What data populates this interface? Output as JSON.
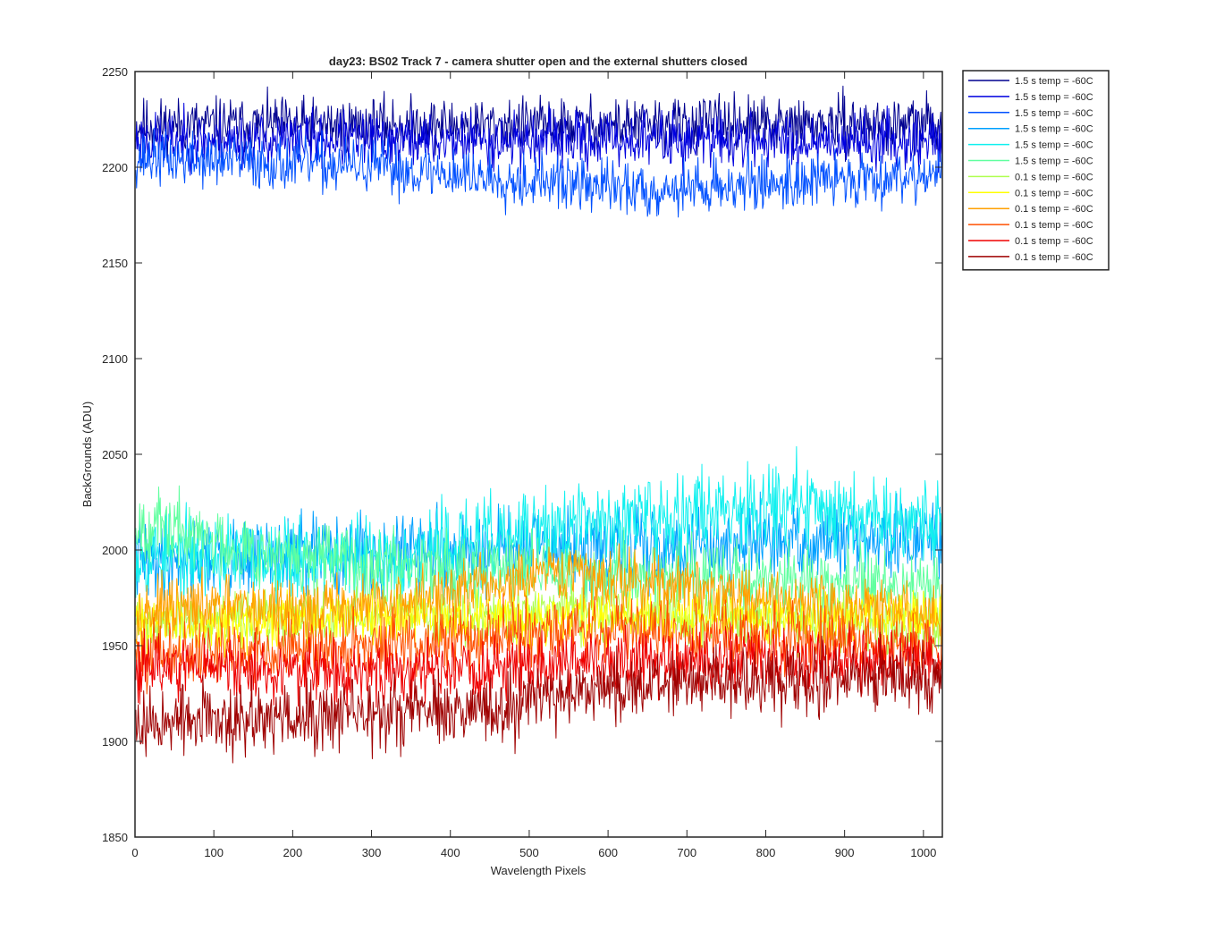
{
  "chart_data": {
    "type": "line",
    "title": "day23: BS02  Track 7 - camera shutter open and the external shutters closed",
    "xlabel": "Wavelength Pixels",
    "ylabel": "BackGrounds (ADU)",
    "xlim": [
      0,
      1024
    ],
    "ylim": [
      1850,
      2250
    ],
    "xticks": [
      0,
      100,
      200,
      300,
      400,
      500,
      600,
      700,
      800,
      900,
      1000
    ],
    "yticks": [
      1850,
      1900,
      1950,
      2000,
      2050,
      2100,
      2150,
      2200,
      2250
    ],
    "grid": false,
    "legend_position": "outside-top-right",
    "num_points": 1024,
    "series": [
      {
        "name": "1.5 s temp = -60C",
        "color": "#00008f",
        "baseline": [
          [
            0,
            2222
          ],
          [
            1024,
            2222
          ]
        ],
        "noise": 7,
        "seed": 11
      },
      {
        "name": "1.5 s temp = -60C",
        "color": "#0000df",
        "baseline": [
          [
            0,
            2214
          ],
          [
            1024,
            2214
          ]
        ],
        "noise": 7,
        "seed": 23
      },
      {
        "name": "1.5 s temp = -60C",
        "color": "#0050ff",
        "baseline": [
          [
            0,
            2205
          ],
          [
            300,
            2200
          ],
          [
            650,
            2188
          ],
          [
            1024,
            2197
          ]
        ],
        "noise": 7,
        "seed": 37
      },
      {
        "name": "1.5 s temp = -60C",
        "color": "#00a0ff",
        "baseline": [
          [
            0,
            1995
          ],
          [
            512,
            2000
          ],
          [
            1024,
            2005
          ]
        ],
        "noise": 10,
        "seed": 41
      },
      {
        "name": "1.5 s temp = -60C",
        "color": "#10f0ef",
        "baseline": [
          [
            0,
            1998
          ],
          [
            300,
            1995
          ],
          [
            600,
            2015
          ],
          [
            800,
            2025
          ],
          [
            1024,
            2015
          ]
        ],
        "noise": 11,
        "seed": 53
      },
      {
        "name": "1.5 s temp = -60C",
        "color": "#60ff9f",
        "baseline": [
          [
            0,
            2015
          ],
          [
            200,
            1995
          ],
          [
            500,
            1990
          ],
          [
            1024,
            1980
          ]
        ],
        "noise": 9,
        "seed": 67
      },
      {
        "name": "0.1 s temp = -60C",
        "color": "#afff50",
        "baseline": [
          [
            0,
            1962
          ],
          [
            500,
            1968
          ],
          [
            1024,
            1960
          ]
        ],
        "noise": 7,
        "seed": 71
      },
      {
        "name": "0.1 s temp = -60C",
        "color": "#ffff00",
        "baseline": [
          [
            0,
            1962
          ],
          [
            500,
            1965
          ],
          [
            1024,
            1965
          ]
        ],
        "noise": 7,
        "seed": 83
      },
      {
        "name": "0.1 s temp = -60C",
        "color": "#ffa000",
        "baseline": [
          [
            0,
            1968
          ],
          [
            300,
            1970
          ],
          [
            550,
            1988
          ],
          [
            800,
            1975
          ],
          [
            1024,
            1965
          ]
        ],
        "noise": 8,
        "seed": 97
      },
      {
        "name": "0.1 s temp = -60C",
        "color": "#ff5000",
        "baseline": [
          [
            0,
            1945
          ],
          [
            300,
            1950
          ],
          [
            550,
            1960
          ],
          [
            800,
            1955
          ],
          [
            1024,
            1950
          ]
        ],
        "noise": 8,
        "seed": 101
      },
      {
        "name": "0.1 s temp = -60C",
        "color": "#ef0000",
        "baseline": [
          [
            0,
            1940
          ],
          [
            300,
            1935
          ],
          [
            600,
            1942
          ],
          [
            1024,
            1942
          ]
        ],
        "noise": 8,
        "seed": 113
      },
      {
        "name": "0.1 s temp = -60C",
        "color": "#9f0000",
        "baseline": [
          [
            0,
            1910
          ],
          [
            400,
            1915
          ],
          [
            600,
            1928
          ],
          [
            1024,
            1935
          ]
        ],
        "noise": 9,
        "seed": 127
      }
    ]
  }
}
